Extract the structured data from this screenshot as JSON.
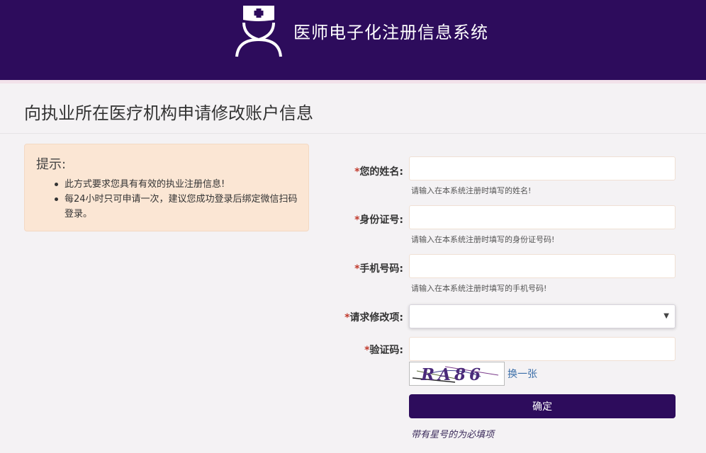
{
  "header": {
    "title": "医师电子化注册信息系统",
    "logo_icon": "nurse-cap-person-icon",
    "background_color": "#2d0c5c"
  },
  "page": {
    "title": "向执业所在医疗机构申请修改账户信息"
  },
  "notice": {
    "heading": "提示:",
    "items": [
      "此方式要求您具有有效的执业注册信息!",
      "每24小时只可申请一次，建议您成功登录后绑定微信扫码登录。"
    ],
    "background_color": "#fbe6d4"
  },
  "form": {
    "required_mark": "*",
    "name": {
      "label": "您的姓名:",
      "value": "",
      "hint": "请输入在本系统注册时填写的姓名!"
    },
    "id_number": {
      "label": "身份证号:",
      "value": "",
      "hint": "请输入在本系统注册时填写的身份证号码!"
    },
    "phone": {
      "label": "手机号码:",
      "value": "",
      "hint": "请输入在本系统注册时填写的手机号码!"
    },
    "modify_item": {
      "label": "请求修改项:",
      "selected": ""
    },
    "captcha": {
      "label": "验证码:",
      "value": "",
      "image_text": "RA86",
      "refresh_label": "换一张"
    },
    "submit_label": "确定",
    "required_note": "带有星号的为必填项"
  }
}
